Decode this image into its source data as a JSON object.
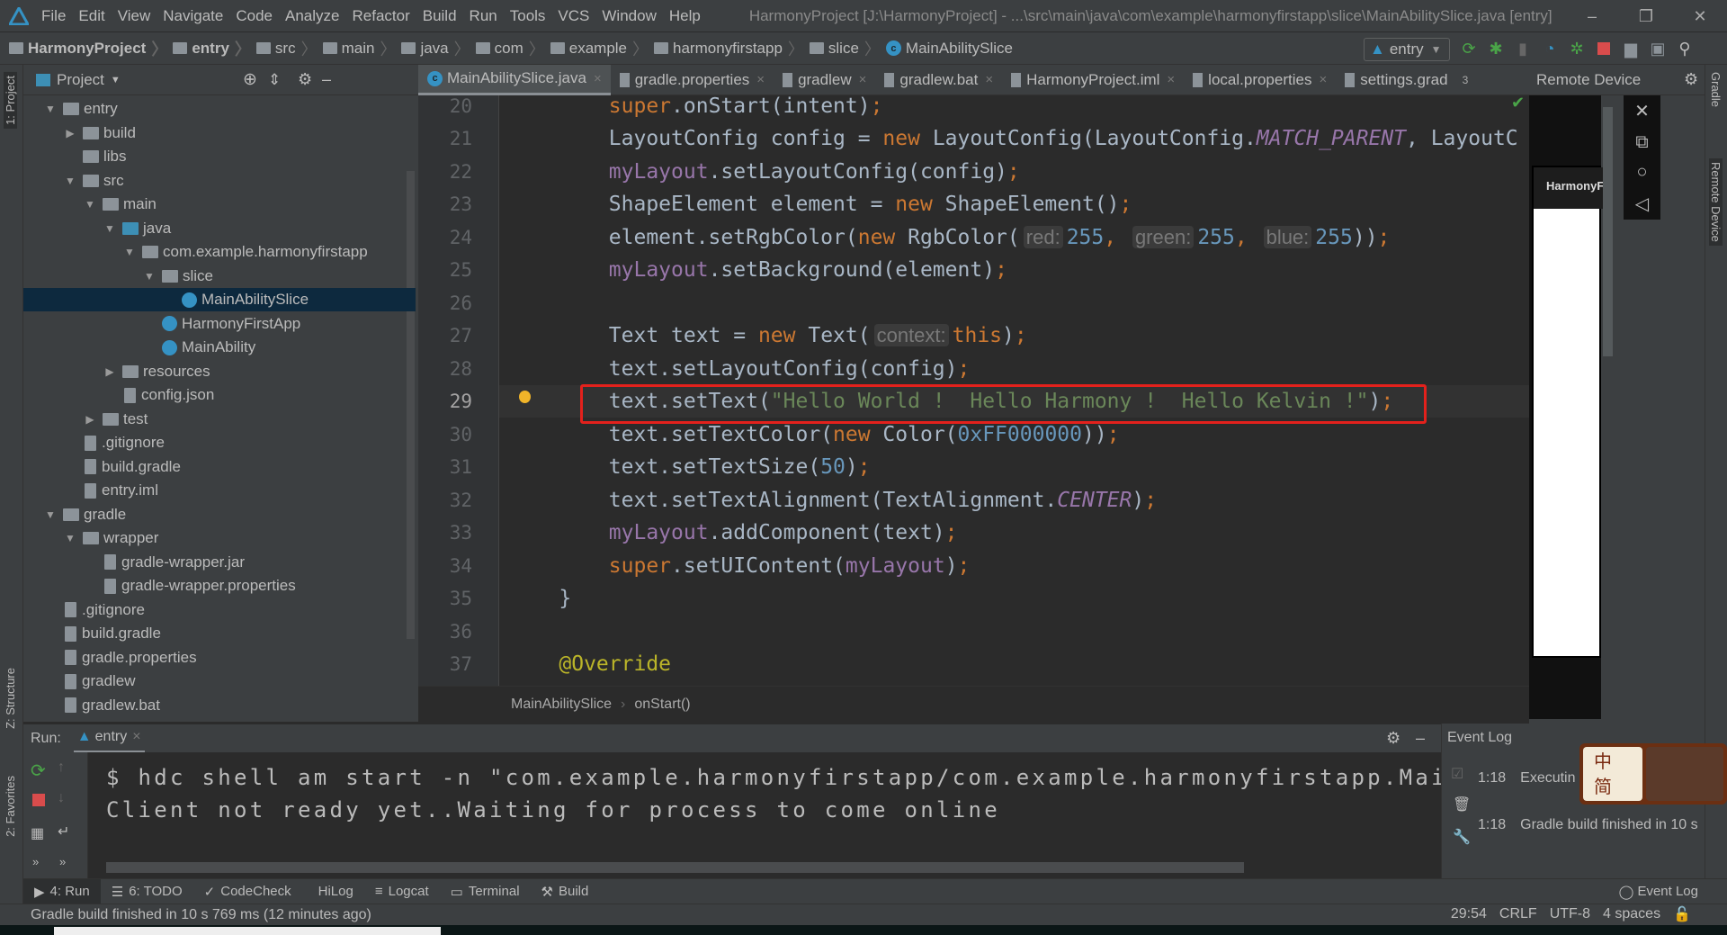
{
  "menubar": {
    "items": [
      "File",
      "Edit",
      "View",
      "Navigate",
      "Code",
      "Analyze",
      "Refactor",
      "Build",
      "Run",
      "Tools",
      "VCS",
      "Window",
      "Help"
    ],
    "title": "HarmonyProject [J:\\HarmonyProject] - ...\\src\\main\\java\\com\\example\\harmonyfirstapp\\slice\\MainAbilitySlice.java [entry]"
  },
  "navbar": {
    "crumbs": [
      "HarmonyProject",
      "entry",
      "src",
      "main",
      "java",
      "com",
      "example",
      "harmonyfirstapp",
      "slice",
      "MainAbilitySlice"
    ],
    "run_config": "entry"
  },
  "left_stripe": {
    "project": "1: Project",
    "structure": "Z: Structure",
    "favorites": "2: Favorites"
  },
  "right_stripe": {
    "gradle": "Gradle",
    "remote": "Remote Device"
  },
  "project": {
    "title": "Project",
    "tree": [
      {
        "label": "entry",
        "depth": 0,
        "arrow": "down",
        "icon": "module"
      },
      {
        "label": "build",
        "depth": 1,
        "arrow": "right",
        "icon": "folder"
      },
      {
        "label": "libs",
        "depth": 1,
        "arrow": "",
        "icon": "folder"
      },
      {
        "label": "src",
        "depth": 1,
        "arrow": "down",
        "icon": "folder"
      },
      {
        "label": "main",
        "depth": 2,
        "arrow": "down",
        "icon": "folder"
      },
      {
        "label": "java",
        "depth": 3,
        "arrow": "down",
        "icon": "source-folder"
      },
      {
        "label": "com.example.harmonyfirstapp",
        "depth": 4,
        "arrow": "down",
        "icon": "package"
      },
      {
        "label": "slice",
        "depth": 5,
        "arrow": "down",
        "icon": "package"
      },
      {
        "label": "MainAbilitySlice",
        "depth": 6,
        "arrow": "",
        "icon": "class",
        "selected": true
      },
      {
        "label": "HarmonyFirstApp",
        "depth": 5,
        "arrow": "",
        "icon": "class"
      },
      {
        "label": "MainAbility",
        "depth": 5,
        "arrow": "",
        "icon": "class"
      },
      {
        "label": "resources",
        "depth": 3,
        "arrow": "right",
        "icon": "resources"
      },
      {
        "label": "config.json",
        "depth": 3,
        "arrow": "",
        "icon": "file"
      },
      {
        "label": "test",
        "depth": 2,
        "arrow": "right",
        "icon": "folder"
      },
      {
        "label": ".gitignore",
        "depth": 1,
        "arrow": "",
        "icon": "file"
      },
      {
        "label": "build.gradle",
        "depth": 1,
        "arrow": "",
        "icon": "gradle"
      },
      {
        "label": "entry.iml",
        "depth": 1,
        "arrow": "",
        "icon": "file"
      },
      {
        "label": "gradle",
        "depth": 0,
        "arrow": "down",
        "icon": "folder"
      },
      {
        "label": "wrapper",
        "depth": 1,
        "arrow": "down",
        "icon": "folder"
      },
      {
        "label": "gradle-wrapper.jar",
        "depth": 2,
        "arrow": "",
        "icon": "file"
      },
      {
        "label": "gradle-wrapper.properties",
        "depth": 2,
        "arrow": "",
        "icon": "file"
      },
      {
        "label": ".gitignore",
        "depth": 0,
        "arrow": "",
        "icon": "file"
      },
      {
        "label": "build.gradle",
        "depth": 0,
        "arrow": "",
        "icon": "gradle"
      },
      {
        "label": "gradle.properties",
        "depth": 0,
        "arrow": "",
        "icon": "file"
      },
      {
        "label": "gradlew",
        "depth": 0,
        "arrow": "",
        "icon": "file"
      },
      {
        "label": "gradlew.bat",
        "depth": 0,
        "arrow": "",
        "icon": "file"
      },
      {
        "label": "HarmonyProject.iml",
        "depth": 0,
        "arrow": "",
        "icon": "file"
      }
    ]
  },
  "tabs": [
    {
      "label": "MainAbilitySlice.java",
      "active": true
    },
    {
      "label": "gradle.properties"
    },
    {
      "label": "gradlew"
    },
    {
      "label": "gradlew.bat"
    },
    {
      "label": "HarmonyProject.iml"
    },
    {
      "label": "local.properties"
    },
    {
      "label": "settings.grad"
    }
  ],
  "tabs_overflow": "3",
  "editor": {
    "current_line": 29,
    "lines": [
      {
        "n": 20,
        "t": [
          [
            "        "
          ],
          [
            "super",
            "kw"
          ],
          [
            ".onStart(intent)"
          ],
          [
            ";",
            "kw"
          ]
        ]
      },
      {
        "n": 21,
        "t": [
          [
            "        LayoutConfig config = "
          ],
          [
            "new",
            "kw"
          ],
          [
            " LayoutConfig(LayoutConfig."
          ],
          [
            "MATCH_PARENT",
            "const"
          ],
          [
            ", LayoutC"
          ]
        ]
      },
      {
        "n": 22,
        "t": [
          [
            "        "
          ],
          [
            "myLayout",
            "fld"
          ],
          [
            ".setLayoutConfig(config)"
          ],
          [
            ";",
            "kw"
          ]
        ]
      },
      {
        "n": 23,
        "t": [
          [
            "        ShapeElement element = "
          ],
          [
            "new",
            "kw"
          ],
          [
            " ShapeElement()"
          ],
          [
            ";",
            "kw"
          ]
        ]
      },
      {
        "n": 24,
        "t": [
          [
            "        element.setRgbColor("
          ],
          [
            "new",
            "kw"
          ],
          [
            " RgbColor("
          ],
          [
            "red:",
            "hint"
          ],
          [
            "255",
            "num"
          ],
          [
            ", ",
            "kw"
          ],
          [
            "green:",
            "hint"
          ],
          [
            "255",
            "num"
          ],
          [
            ", ",
            "kw"
          ],
          [
            "blue:",
            "hint"
          ],
          [
            "255",
            "num"
          ],
          [
            "))"
          ],
          [
            ";",
            "kw"
          ]
        ]
      },
      {
        "n": 25,
        "t": [
          [
            "        "
          ],
          [
            "myLayout",
            "fld"
          ],
          [
            ".setBackground(element)"
          ],
          [
            ";",
            "kw"
          ]
        ]
      },
      {
        "n": 26,
        "t": []
      },
      {
        "n": 27,
        "t": [
          [
            "        Text text = "
          ],
          [
            "new",
            "kw"
          ],
          [
            " Text("
          ],
          [
            "context:",
            "hint"
          ],
          [
            "this",
            "kw"
          ],
          [
            ")"
          ],
          [
            ";",
            "kw"
          ]
        ]
      },
      {
        "n": 28,
        "t": [
          [
            "        text.setLayoutConfig(config)"
          ],
          [
            ";",
            "kw"
          ]
        ]
      },
      {
        "n": 29,
        "t": [
          [
            "        text.setText("
          ],
          [
            "\"Hello World !  Hello Harmony !  Hello Kelvin !\"",
            "str"
          ],
          [
            ")"
          ],
          [
            ";",
            "kw"
          ]
        ]
      },
      {
        "n": 30,
        "t": [
          [
            "        text.setTextColor("
          ],
          [
            "new",
            "kw"
          ],
          [
            " Color("
          ],
          [
            "0xFF000000",
            "num"
          ],
          [
            "))"
          ],
          [
            ";",
            "kw"
          ]
        ]
      },
      {
        "n": 31,
        "t": [
          [
            "        text.setTextSize("
          ],
          [
            "50",
            "num"
          ],
          [
            ")"
          ],
          [
            ";",
            "kw"
          ]
        ]
      },
      {
        "n": 32,
        "t": [
          [
            "        text.setTextAlignment(TextAlignment."
          ],
          [
            "CENTER",
            "const"
          ],
          [
            ")"
          ],
          [
            ";",
            "kw"
          ]
        ]
      },
      {
        "n": 33,
        "t": [
          [
            "        "
          ],
          [
            "myLayout",
            "fld"
          ],
          [
            ".addComponent(text)"
          ],
          [
            ";",
            "kw"
          ]
        ]
      },
      {
        "n": 34,
        "t": [
          [
            "        "
          ],
          [
            "super",
            "kw"
          ],
          [
            ".setUIContent("
          ],
          [
            "myLayout",
            "fld"
          ],
          [
            ")"
          ],
          [
            ";",
            "kw"
          ]
        ]
      },
      {
        "n": 35,
        "t": [
          [
            "    }"
          ]
        ]
      },
      {
        "n": 36,
        "t": []
      },
      {
        "n": 37,
        "t": [
          [
            "    "
          ],
          [
            "@Override",
            "ann"
          ]
        ]
      }
    ],
    "breadcrumb": [
      "MainAbilitySlice",
      "onStart()"
    ]
  },
  "remote_device": {
    "title": "Remote Device",
    "app_title": "HarmonyFirstApp"
  },
  "run": {
    "label": "Run:",
    "tab": "entry",
    "console": [
      "$ hdc shell am start -n \"com.example.harmonyfirstapp/com.example.harmonyfirstapp.MainAbilityShellActivity\"",
      "Client not ready yet..Waiting for process to come online"
    ]
  },
  "event_log": {
    "title": "Event Log",
    "entries": [
      {
        "time": "1:18",
        "text": "Executin"
      },
      {
        "time": "1:18",
        "text": "Gradle build finished in 10 s"
      }
    ]
  },
  "bottom_tabs": [
    "4: Run",
    "6: TODO",
    "CodeCheck",
    "HiLog",
    "Logcat",
    "Terminal",
    "Build"
  ],
  "bottom_right_tab": "Event Log",
  "status": {
    "message": "Gradle build finished in 10 s 769 ms (12 minutes ago)",
    "position": "29:54",
    "line_sep": "CRLF",
    "encoding": "UTF-8",
    "indent": "4 spaces"
  },
  "ime": {
    "line1": "中",
    "line2": "简"
  },
  "colors": {
    "keyword": "#cc7832",
    "field": "#9876aa",
    "number": "#6897bb",
    "string": "#6a8759",
    "highlight_box": "#e3211c",
    "selection": "#0d293e"
  }
}
